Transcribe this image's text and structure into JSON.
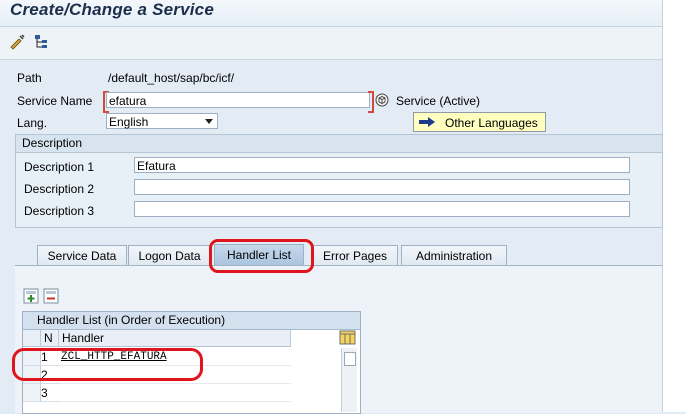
{
  "window": {
    "title": "Create/Change a Service"
  },
  "toolbar": {
    "icons": [
      "edit-icon",
      "hierarchy-icon"
    ]
  },
  "form": {
    "path_label": "Path",
    "path_value": "/default_host/sap/bc/icf/",
    "service_name_label": "Service Name",
    "service_name_value": "efatura",
    "service_status": "Service (Active)",
    "lang_label": "Lang.",
    "lang_value": "English",
    "other_languages_label": "Other Languages"
  },
  "description": {
    "header": "Description",
    "rows": [
      {
        "label": "Description 1",
        "value": "Efatura"
      },
      {
        "label": "Description 2",
        "value": ""
      },
      {
        "label": "Description 3",
        "value": ""
      }
    ]
  },
  "tabs": [
    {
      "label": "Service Data",
      "active": false
    },
    {
      "label": "Logon Data",
      "active": false
    },
    {
      "label": "Handler List",
      "active": true
    },
    {
      "label": "Error Pages",
      "active": false
    },
    {
      "label": "Administration",
      "active": false
    }
  ],
  "handler_table": {
    "title": "Handler List (in Order of Execution)",
    "columns": [
      "N",
      "Handler"
    ],
    "rows": [
      {
        "n": "1",
        "handler": "ZCL_HTTP_EFATURA"
      },
      {
        "n": "2",
        "handler": ""
      },
      {
        "n": "3",
        "handler": ""
      }
    ]
  },
  "colors": {
    "highlight": "#e0141c",
    "accent": "#ffffc0"
  }
}
